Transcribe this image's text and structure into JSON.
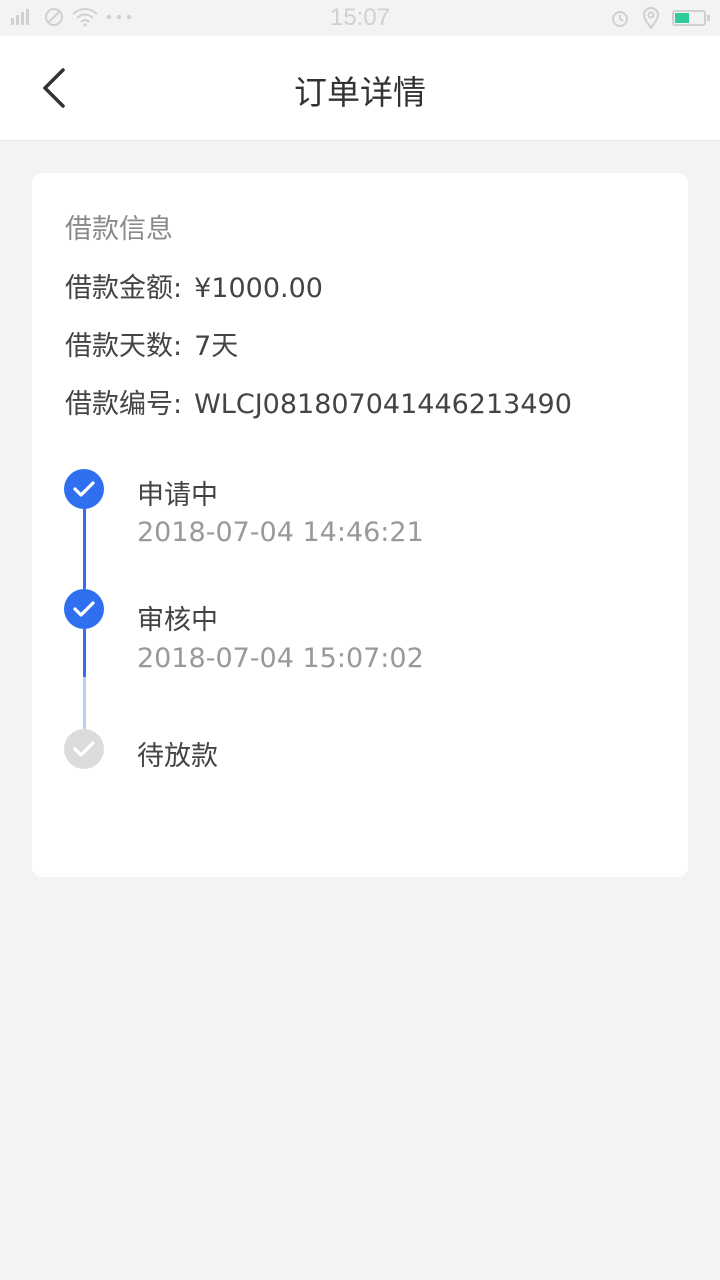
{
  "status_bar": {
    "time": "15:07",
    "left_icons": [
      "signal-icon",
      "no-sim-icon",
      "wifi-icon",
      "more-dots-icon"
    ],
    "right_icons": [
      "alarm-icon",
      "location-icon",
      "battery-icon"
    ],
    "battery_color": "#2ecc9a"
  },
  "nav": {
    "title": "订单详情",
    "back_icon": "chevron-left-icon"
  },
  "loan_info": {
    "section_title": "借款信息",
    "amount_label": "借款金额:",
    "amount_value": "¥1000.00",
    "days_label": "借款天数:",
    "days_value": "7天",
    "number_label": "借款编号:",
    "number_value": "WLCJ081807041446213490"
  },
  "timeline": {
    "steps": [
      {
        "label": "申请中",
        "time": "2018-07-04 14:46:21",
        "status": "done"
      },
      {
        "label": "审核中",
        "time": "2018-07-04 15:07:02",
        "status": "done"
      },
      {
        "label": "待放款",
        "time": "",
        "status": "pending"
      }
    ],
    "done_color": "#2f6ff0",
    "pending_color": "#dcdcdc"
  }
}
